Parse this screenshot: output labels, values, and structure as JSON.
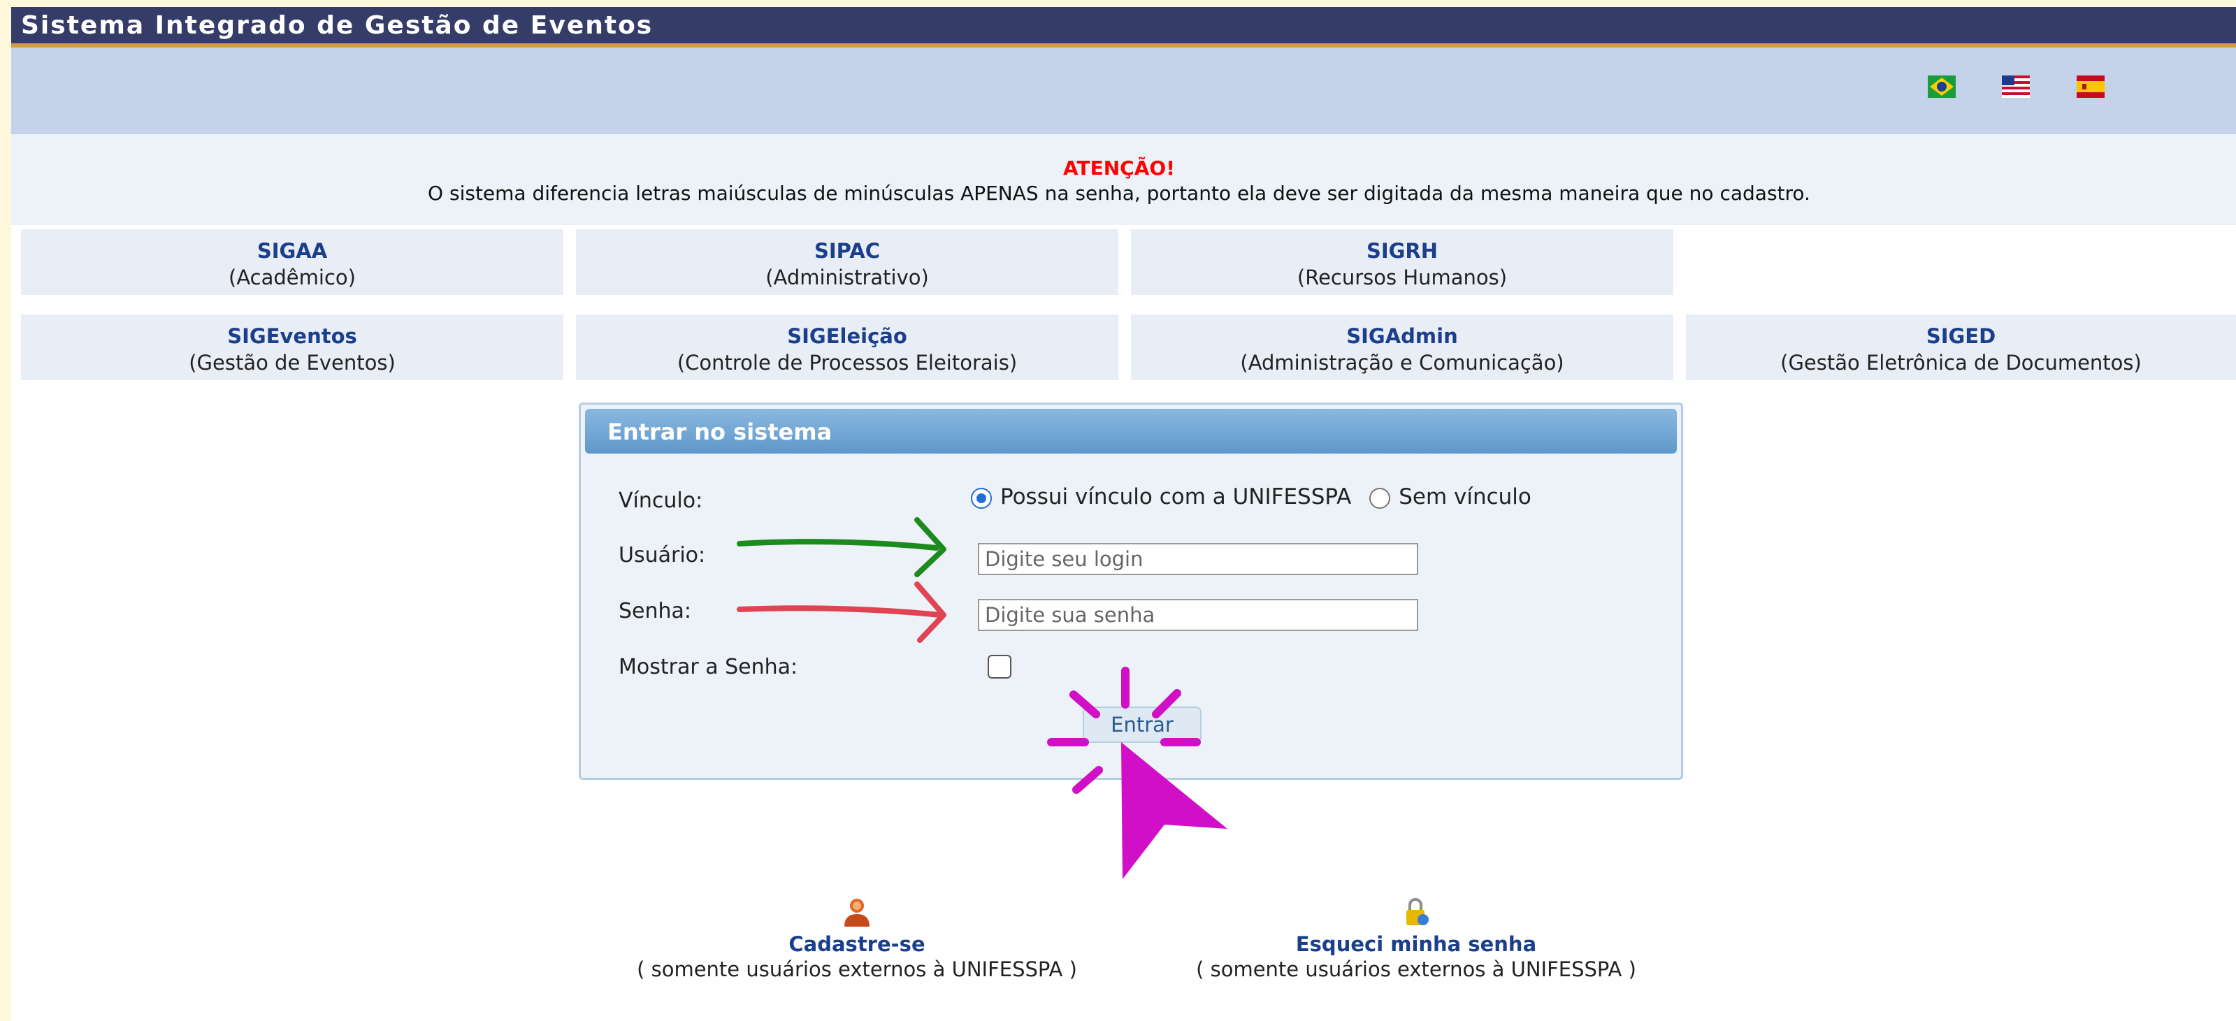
{
  "header": {
    "title": "Sistema Integrado de Gestão de Eventos"
  },
  "languages": [
    {
      "icon": "brazil-flag-icon"
    },
    {
      "icon": "usa-flag-icon"
    },
    {
      "icon": "spain-flag-icon"
    }
  ],
  "notice": {
    "heading": "ATENÇÃO!",
    "text": "O sistema diferencia letras maiúsculas de minúsculas APENAS na senha, portanto ela deve ser digitada da mesma maneira que no cadastro."
  },
  "systems_row1": [
    {
      "name": "SIGAA",
      "desc": "(Acadêmico)"
    },
    {
      "name": "SIPAC",
      "desc": "(Administrativo)"
    },
    {
      "name": "SIGRH",
      "desc": "(Recursos Humanos)"
    }
  ],
  "systems_row2": [
    {
      "name": "SIGEventos",
      "desc": "(Gestão de Eventos)"
    },
    {
      "name": "SIGEleição",
      "desc": "(Controle de Processos Eleitorais)"
    },
    {
      "name": "SIGAdmin",
      "desc": "(Administração e Comunicação)"
    },
    {
      "name": "SIGED",
      "desc": "(Gestão Eletrônica de Documentos)"
    }
  ],
  "login": {
    "title": "Entrar no sistema",
    "vinculo_label": "Vínculo:",
    "vinculo_options": [
      "Possui vínculo com a UNIFESSPA",
      "Sem vínculo"
    ],
    "vinculo_selected": "Possui vínculo com a UNIFESSPA",
    "usuario_label": "Usuário:",
    "usuario_placeholder": "Digite seu login",
    "usuario_value": "",
    "senha_label": "Senha:",
    "senha_placeholder": "Digite sua senha",
    "senha_value": "",
    "mostrar_label": "Mostrar a Senha:",
    "mostrar_checked": false,
    "submit_label": "Entrar"
  },
  "bottom_links": [
    {
      "icon": "user-register-icon",
      "label": "Cadastre-se",
      "sub": "( somente usuários externos à UNIFESSPA )"
    },
    {
      "icon": "lock-key-icon",
      "label": "Esqueci minha senha",
      "sub": "( somente usuários externos à UNIFESSPA )"
    }
  ],
  "annotations": {
    "usuario_arrow_color": "#1d8a1d",
    "senha_arrow_color": "#e04452",
    "cursor_color": "#d10fc6"
  }
}
